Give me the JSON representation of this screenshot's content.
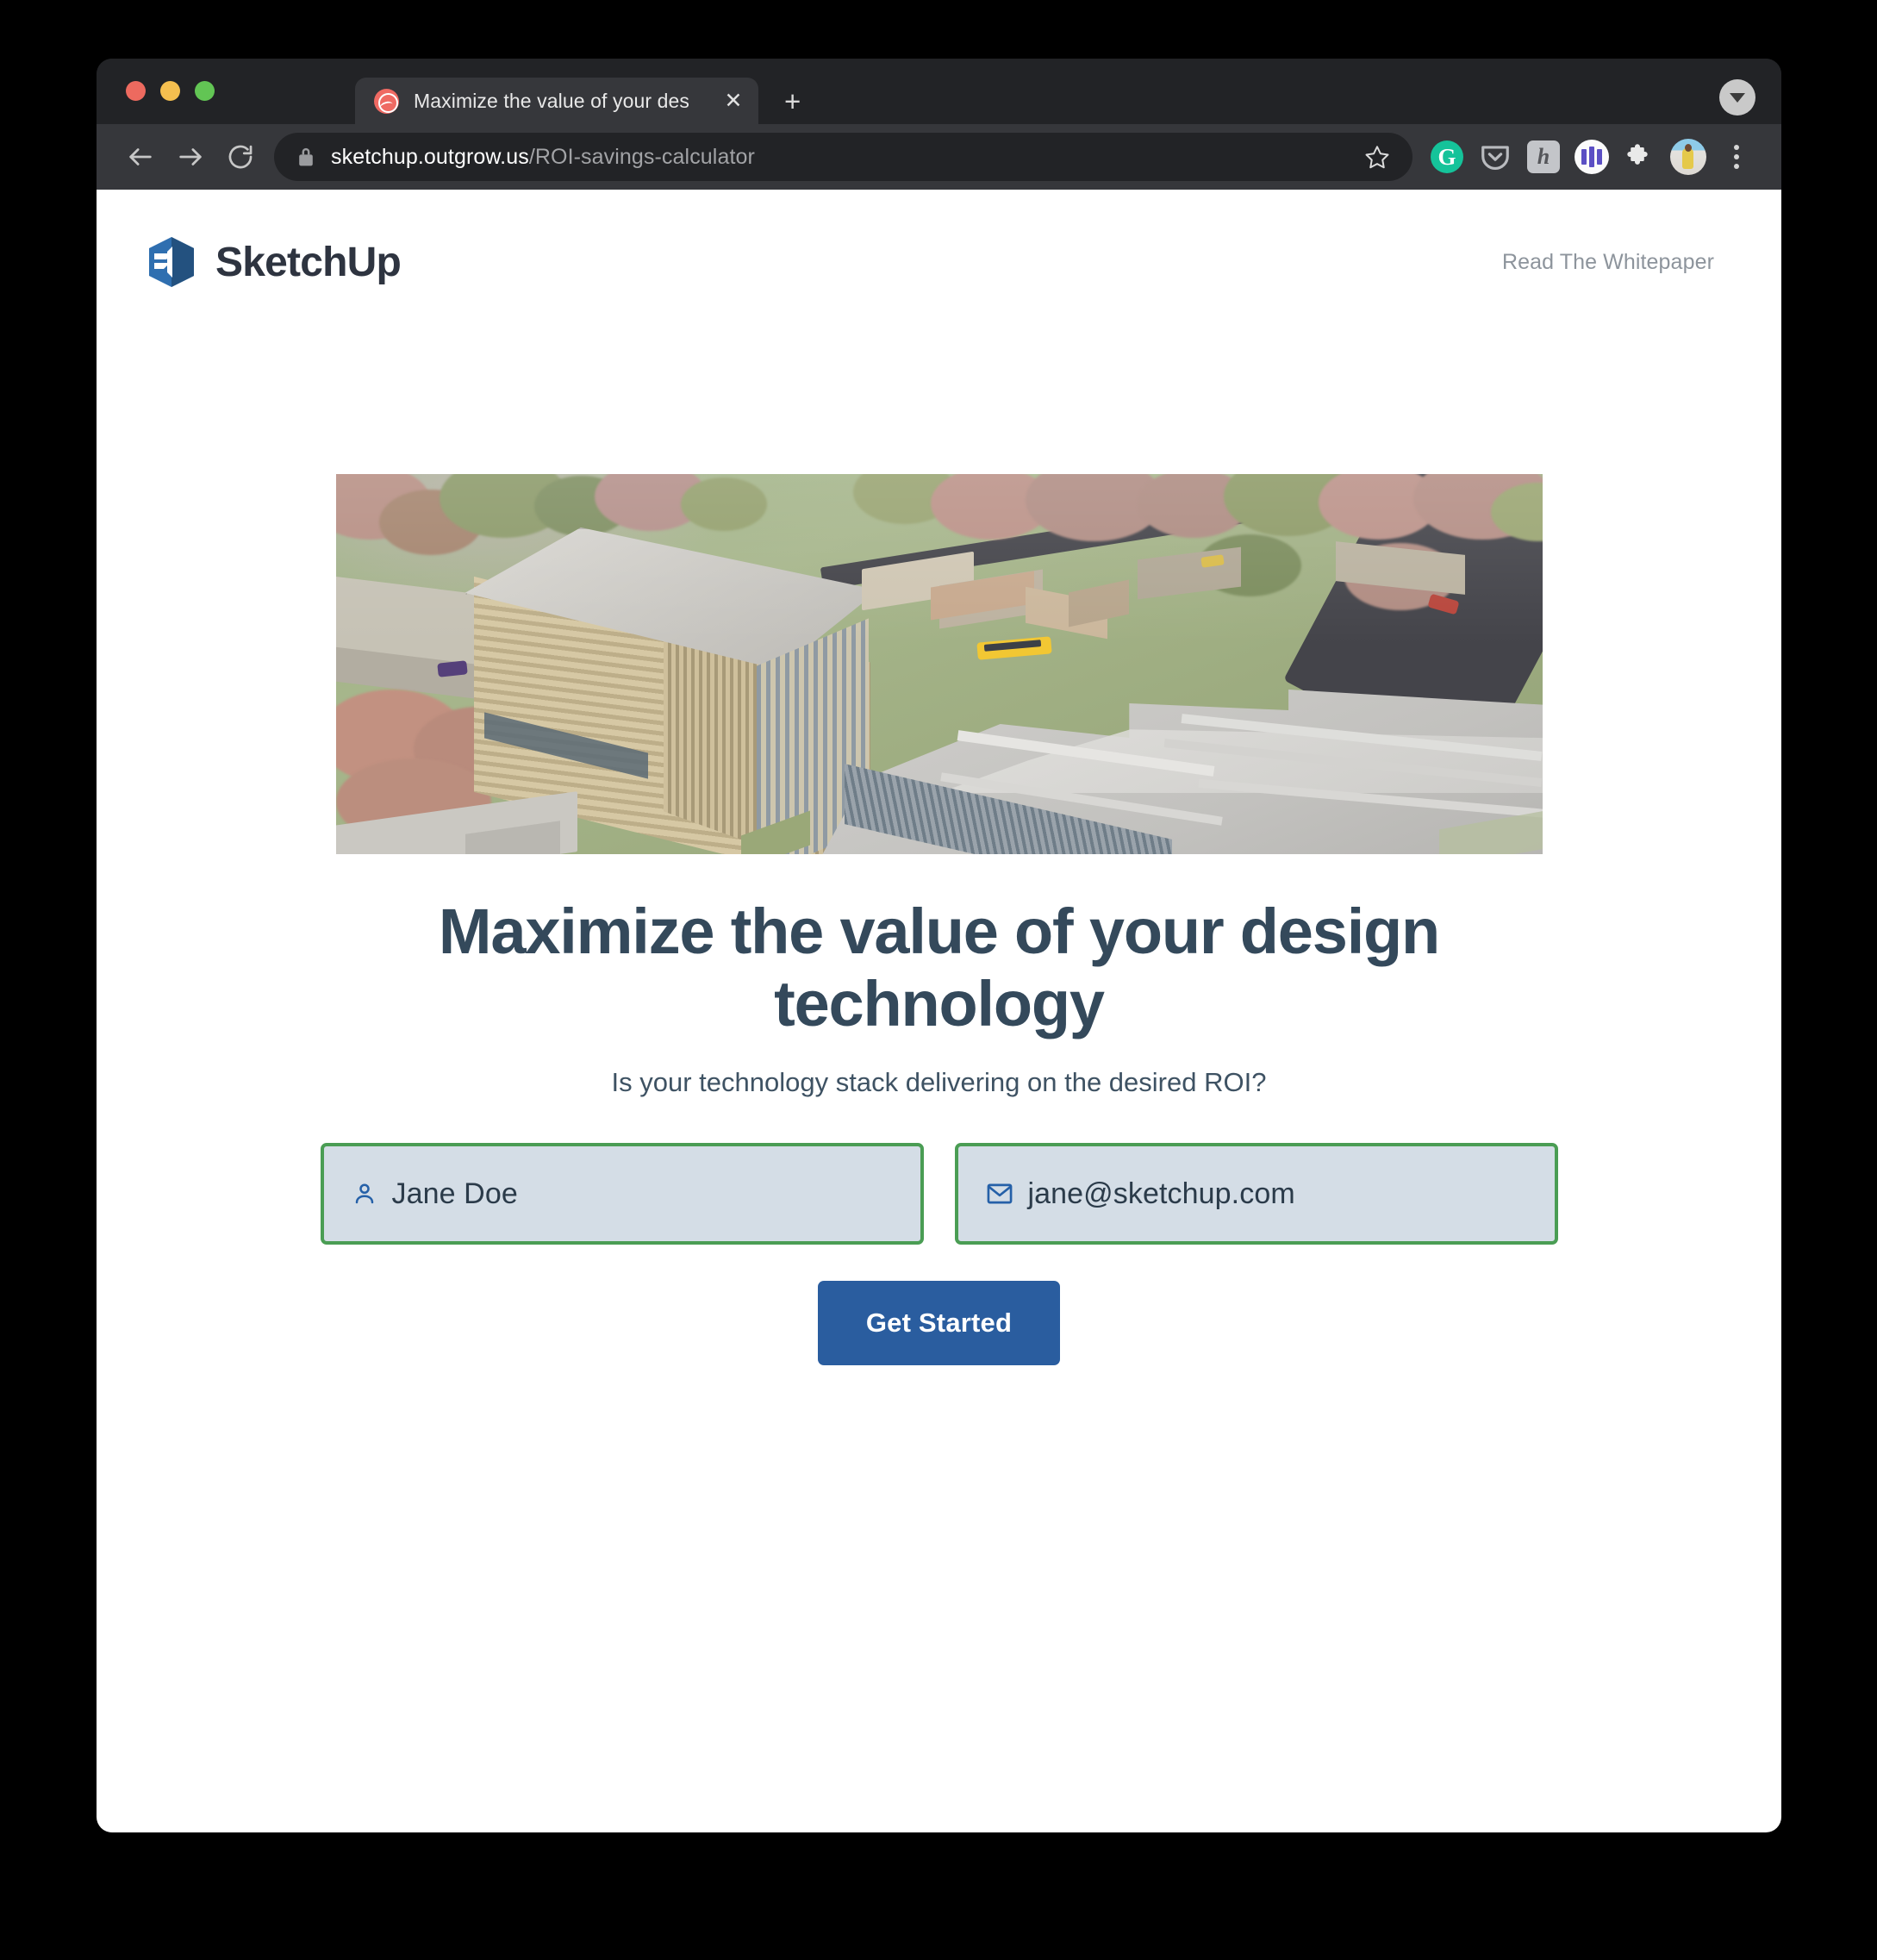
{
  "browser": {
    "traffic_lights": [
      "close",
      "minimize",
      "maximize"
    ],
    "tab": {
      "title": "Maximize the value of your des",
      "favicon": "outgrow-favicon",
      "close_label": "✕"
    },
    "new_tab_label": "+",
    "tab_list_icon": "chevron-down-icon",
    "toolbar": {
      "back_icon": "back-arrow-icon",
      "forward_icon": "forward-arrow-icon",
      "reload_icon": "reload-icon",
      "lock_icon": "lock-icon",
      "url_domain": "sketchup.outgrow.us",
      "url_path": "/ROI-savings-calculator",
      "bookmark_icon": "star-icon",
      "extensions": [
        {
          "name": "grammarly-extension-icon",
          "glyph": "G"
        },
        {
          "name": "pocket-extension-icon",
          "glyph": ""
        },
        {
          "name": "honey-extension-icon",
          "glyph": "h"
        },
        {
          "name": "instapaper-extension-icon",
          "glyph": ""
        },
        {
          "name": "extensions-puzzle-icon",
          "glyph": ""
        },
        {
          "name": "profile-avatar",
          "glyph": ""
        }
      ],
      "menu_icon": "kebab-menu-icon"
    }
  },
  "site": {
    "logo_text": "SketchUp",
    "logo_icon": "sketchup-logo-mark",
    "whitepaper_link": "Read The Whitepaper"
  },
  "hero": {
    "image_alt": "Aerial architectural rendering of a modern campus building",
    "headline": "Maximize the value of your design technology",
    "subhead": "Is your technology stack delivering on the desired ROI?"
  },
  "form": {
    "name_field": {
      "icon": "person-icon",
      "value": "Jane Doe",
      "placeholder": "Jane Doe"
    },
    "email_field": {
      "icon": "envelope-icon",
      "value": "jane@sketchup.com",
      "placeholder": "jane@sketchup.com"
    },
    "submit_label": "Get Started"
  },
  "colors": {
    "headline": "#34495b",
    "cta_bg": "#2a5d9f",
    "field_border": "#4a9d54",
    "field_bg": "#d4dde6",
    "logo_blue": "#2a6cb0",
    "link_gray": "#8d949c"
  }
}
